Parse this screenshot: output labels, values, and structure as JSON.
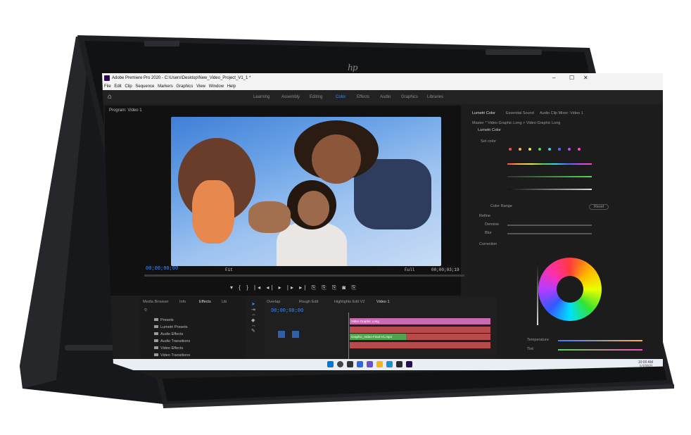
{
  "app": {
    "window_title": "Adobe Premiere Pro 2020 - C:\\Users\\Desktop\\New_Video_Project_V1_1 *",
    "menu": [
      "File",
      "Edit",
      "Clip",
      "Sequence",
      "Markers",
      "Graphics",
      "View",
      "Window",
      "Help"
    ],
    "win_controls": [
      "–",
      "☐",
      "✕"
    ]
  },
  "workspaces": [
    {
      "label": "Learning",
      "active": false
    },
    {
      "label": "Assembly",
      "active": false
    },
    {
      "label": "Editing",
      "active": false
    },
    {
      "label": "Color",
      "active": true
    },
    {
      "label": "Effects",
      "active": false
    },
    {
      "label": "Audio",
      "active": false
    },
    {
      "label": "Graphics",
      "active": false
    },
    {
      "label": "Libraries",
      "active": false
    }
  ],
  "program": {
    "header": "Program: Video 1",
    "timecode_left": "00;00;00;00",
    "fit": "Fit",
    "quality": "Full",
    "timecode_right": "00;00;03;19"
  },
  "lumetri": {
    "tabs": [
      "Lumetri Color",
      "Essential Sound",
      "Audio Clip Mixer: Video 1"
    ],
    "breadcrumb": "Master * Video Graphic Long  >  Video Graphic Long",
    "effect": "Lumetri Color",
    "section_hsl": "Set color",
    "color_range": "Color Range",
    "reset": "Reset",
    "refine_section": "Refine",
    "denoise": "Denoise",
    "blur": "Blur",
    "correction": "Correction",
    "temperature": "Temperature",
    "tint": "Tint"
  },
  "effects_panel": {
    "tabs": [
      "Media Browser",
      "Info",
      "Effects",
      "Lib"
    ],
    "items": [
      "Presets",
      "Lumetri Presets",
      "Audio Effects",
      "Audio Transitions",
      "Video Effects",
      "Video Transitions"
    ]
  },
  "timeline": {
    "tabs": [
      "Overlap",
      "Rough Edit",
      "Highlights Edit V2",
      "Video 1"
    ],
    "timecode": "00;00;00;00",
    "clips": [
      {
        "label": "Video Graphic Long",
        "color": "#c96ab3"
      },
      {
        "label": "Graphic_Video-Final-V1.mp4",
        "color": "#4fa64f"
      },
      {
        "label": "",
        "color": "#b84b4b"
      },
      {
        "label": "",
        "color": "#b84b4b"
      }
    ]
  },
  "taskbar": {
    "time": "10:00 AM",
    "date": "1/1/2021"
  },
  "colors": {
    "accent": "#3d8df5",
    "panel": "#1d1d1d",
    "chassis": "#1e1f22"
  }
}
